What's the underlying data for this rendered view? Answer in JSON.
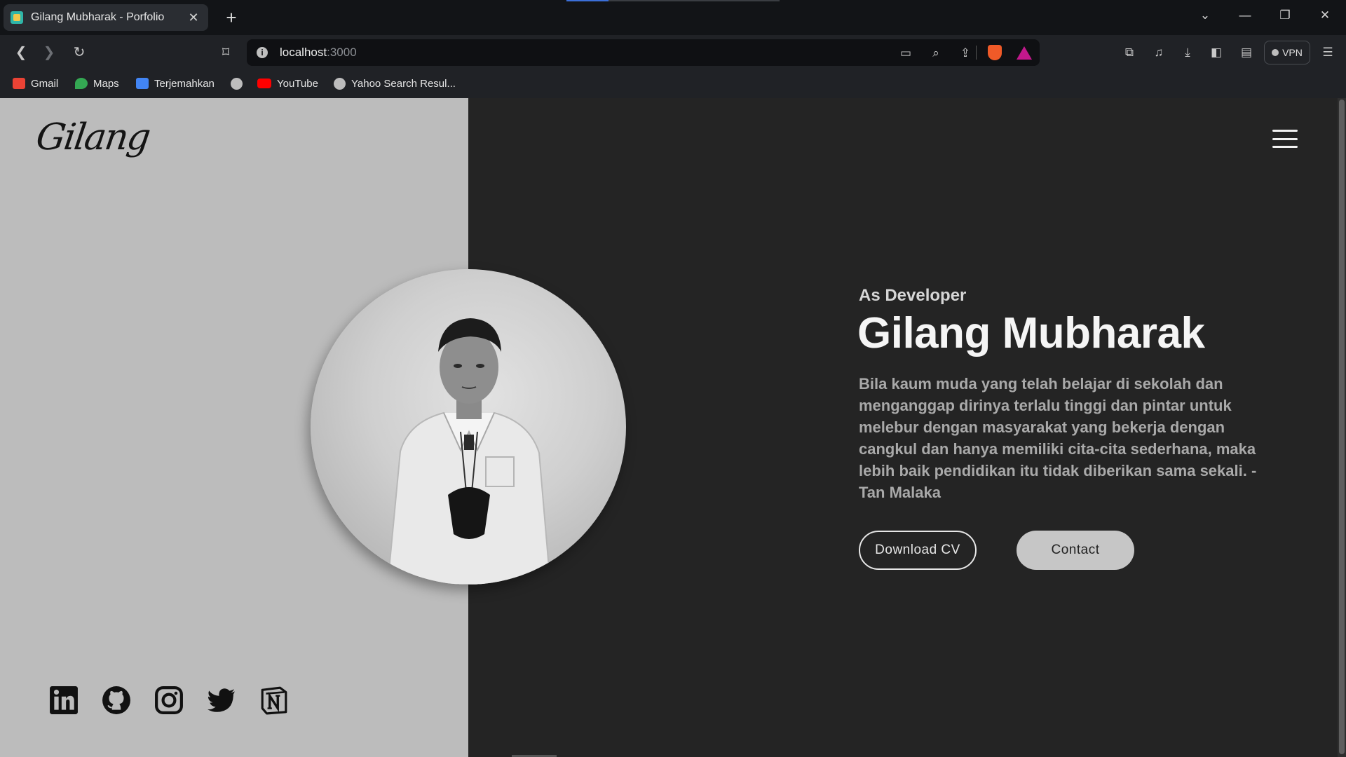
{
  "browser": {
    "tab_title": "Gilang Mubharak - Porfolio",
    "tab_close": "✕",
    "new_tab": "+",
    "url_host": "localhost",
    "url_port": ":3000",
    "vpn_label": "VPN",
    "brand_colors": {
      "brave": "#f05a28",
      "rewards": "#c2188c"
    }
  },
  "bookmarks": [
    {
      "label": "Gmail",
      "icon": "gmail-icon",
      "color": "#ea4335"
    },
    {
      "label": "Maps",
      "icon": "maps-icon",
      "color": "#34a853"
    },
    {
      "label": "Terjemahkan",
      "icon": "translate-icon",
      "color": "#4285f4"
    },
    {
      "label": "",
      "icon": "globe-icon",
      "color": "#bdbdbd"
    },
    {
      "label": "YouTube",
      "icon": "youtube-icon",
      "color": "#ff0000"
    },
    {
      "label": "Yahoo Search Resul...",
      "icon": "globe-icon",
      "color": "#bdbdbd"
    }
  ],
  "page": {
    "logo_text": "Gilang",
    "hero": {
      "subtitle": "As Developer",
      "name": "Gilang Mubharak",
      "quote": "Bila kaum muda yang telah belajar di sekolah dan menganggap dirinya terlalu tinggi dan pintar untuk melebur dengan masyarakat yang bekerja dengan cangkul dan hanya memiliki cita-cita sederhana, maka lebih baik pendidikan itu tidak diberikan sama sekali. - Tan Malaka"
    },
    "buttons": {
      "download_cv": "Download CV",
      "contact": "Contact"
    },
    "socials": [
      {
        "name": "linkedin-icon"
      },
      {
        "name": "github-icon"
      },
      {
        "name": "instagram-icon"
      },
      {
        "name": "twitter-icon"
      },
      {
        "name": "notion-icon"
      }
    ],
    "colors": {
      "left_panel": "#bcbcbc",
      "right_panel": "#242424",
      "heading": "#f5f5f5",
      "body_text": "#a9a9a9"
    }
  }
}
